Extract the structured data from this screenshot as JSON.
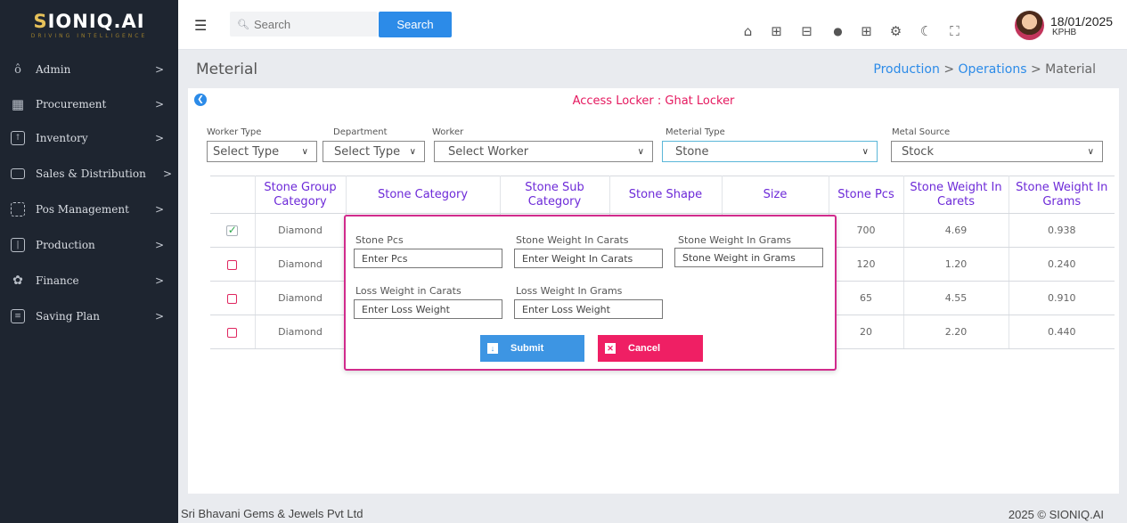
{
  "brand": {
    "logo": "SIONIQ.AI",
    "logo_prefix": "S",
    "logo_rest": "IONIQ.AI",
    "tagline": "DRIVING INTELLIGENCE"
  },
  "sidebar": {
    "items": [
      {
        "label": "Admin",
        "icon": "user-group-icon",
        "glyph": "ô"
      },
      {
        "label": "Procurement",
        "icon": "grid-icon",
        "glyph": "▦"
      },
      {
        "label": "Inventory",
        "icon": "upload-box-icon",
        "glyph": "↑"
      },
      {
        "label": "Sales & Distribution",
        "icon": "monitor-icon",
        "glyph": ""
      },
      {
        "label": "Pos Management",
        "icon": "scan-frame-icon",
        "glyph": ""
      },
      {
        "label": "Production",
        "icon": "columns-icon",
        "glyph": "|"
      },
      {
        "label": "Finance",
        "icon": "gear-flower-icon",
        "glyph": "✿"
      },
      {
        "label": "Saving Plan",
        "icon": "document-icon",
        "glyph": "≡"
      }
    ],
    "chevron": ">"
  },
  "topbar": {
    "search_placeholder": "Search",
    "search_button": "Search",
    "icons": [
      "home-icon",
      "dashboard-icon",
      "ticket-icon",
      "bell-icon",
      "apps-icon",
      "settings-icon",
      "moon-icon",
      "fullscreen-icon"
    ],
    "icon_glyphs": [
      "⌂",
      "⊞",
      "⊟",
      "●",
      "⊞",
      "⚙",
      "☾",
      "⛶"
    ],
    "user_date": "18/01/2025",
    "user_branch": "KPHB"
  },
  "page": {
    "title": "Meterial",
    "breadcrumb": {
      "production": "Production",
      "operations": "Operations",
      "current": "Material",
      "sep": ">"
    }
  },
  "access_locker": {
    "label": "Access Locker : ",
    "value": "Ghat Locker"
  },
  "filters": {
    "worker_type": {
      "label": "Worker Type",
      "value": "Select Type"
    },
    "department": {
      "label": "Department",
      "value": "Select Type"
    },
    "worker": {
      "label": "Worker",
      "value": "Select Worker"
    },
    "material_type": {
      "label": "Meterial Type",
      "value": "Stone"
    },
    "metal_source": {
      "label": "Metal Source",
      "value": "Stock"
    },
    "chevron": "∨"
  },
  "table": {
    "headers": [
      "",
      "Stone Group Category",
      "Stone Category",
      "Stone Sub Category",
      "Stone Shape",
      "Size",
      "Stone Pcs",
      "Stone Weight In Carets",
      "Stone Weight In Grams"
    ],
    "rows": [
      {
        "checked": true,
        "group": "Diamond",
        "pcs": "700",
        "carats": "4.69",
        "grams": "0.938"
      },
      {
        "checked": false,
        "group": "Diamond",
        "pcs": "120",
        "carats": "1.20",
        "grams": "0.240"
      },
      {
        "checked": false,
        "group": "Diamond",
        "pcs": "65",
        "carats": "4.55",
        "grams": "0.910"
      },
      {
        "checked": false,
        "group": "Diamond",
        "pcs": "20",
        "carats": "2.20",
        "grams": "0.440"
      }
    ],
    "check_glyph": "✓"
  },
  "modal": {
    "stone_pcs": {
      "label": "Stone Pcs",
      "placeholder": "Enter Pcs"
    },
    "stone_weight_carats": {
      "label": "Stone Weight In Carats",
      "placeholder": "Enter Weight In Carats"
    },
    "stone_weight_grams": {
      "label": "Stone Weight In Grams",
      "placeholder": "Stone Weight in Grams"
    },
    "loss_weight_carats": {
      "label": "Loss Weight in Carats",
      "placeholder": "Enter Loss Weight"
    },
    "loss_weight_grams": {
      "label": "Loss Weight In Grams",
      "placeholder": "Enter Loss Weight"
    },
    "submit": "Submit",
    "cancel": "Cancel",
    "submit_glyph": "↓",
    "cancel_glyph": "✕",
    "colors": {
      "border": "#d12b8c",
      "submit": "#3d95e3",
      "cancel": "#ef1f64"
    }
  },
  "footer": {
    "company": "Sri Bhavani Gems & Jewels Pvt Ltd",
    "copyright": "2025 © SIONIQ.AI"
  },
  "colors": {
    "sidebar": "#1e2530",
    "accent": "#2c8be8",
    "header_text": "#6d2ad8",
    "locker": "#e5195f"
  }
}
